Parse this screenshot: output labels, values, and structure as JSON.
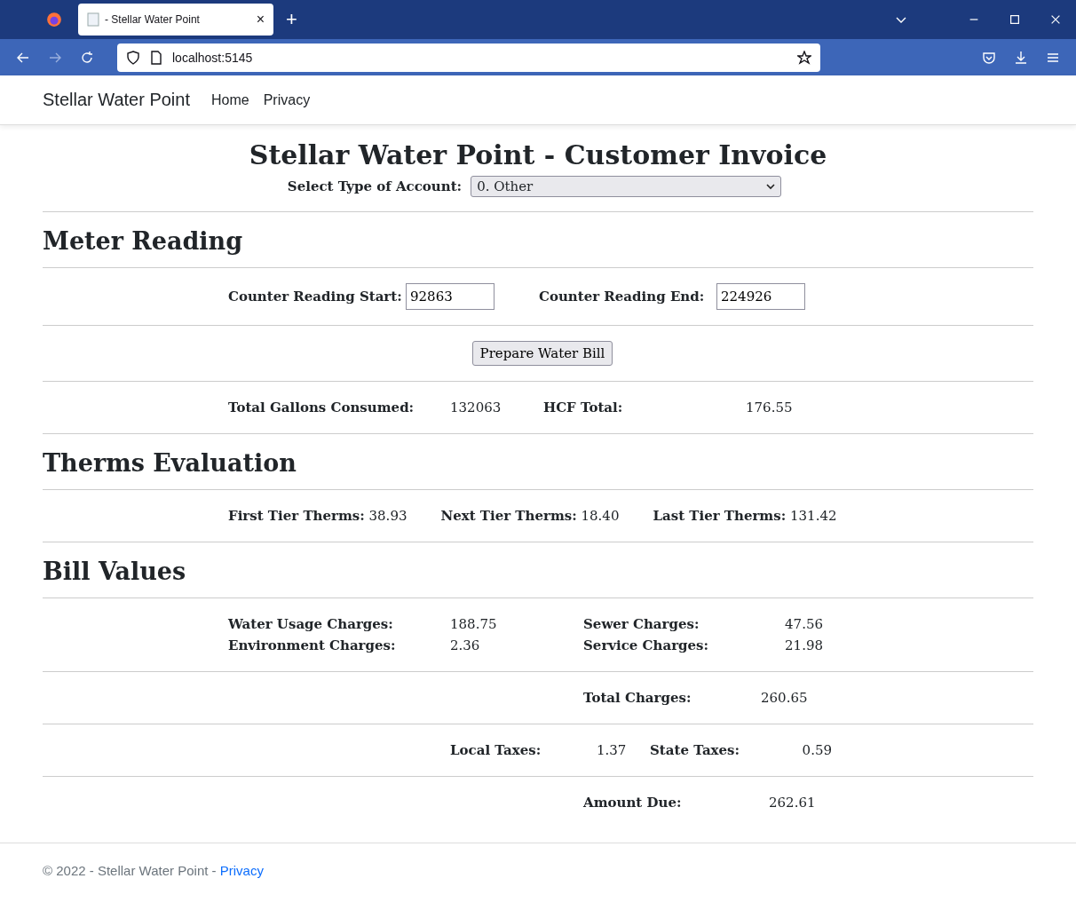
{
  "browser": {
    "tab_title": "- Stellar Water Point",
    "tab_close": "×",
    "new_tab": "+",
    "url": "localhost:5145"
  },
  "navbar": {
    "brand": "Stellar Water Point",
    "links": [
      "Home",
      "Privacy"
    ]
  },
  "title": "Stellar Water Point - Customer Invoice",
  "account": {
    "label": "Select Type of Account:",
    "value": "0. Other"
  },
  "meter": {
    "heading": "Meter Reading",
    "start": {
      "label": "Counter Reading Start:",
      "value": "92863"
    },
    "end": {
      "label": "Counter Reading End:",
      "value": "224926"
    }
  },
  "button": "Prepare Water Bill",
  "consumption": [
    {
      "label": "Total Gallons Consumed:",
      "value": "132063"
    },
    {
      "label": "HCF Total:",
      "value": "176.55"
    }
  ],
  "therms": {
    "heading": "Therms Evaluation",
    "tiers": [
      {
        "label": "First Tier Therms:",
        "value": "38.93"
      },
      {
        "label": "Next Tier Therms:",
        "value": "18.40"
      },
      {
        "label": "Last Tier Therms:",
        "value": "131.42"
      }
    ]
  },
  "bill": {
    "heading": "Bill Values",
    "charges": [
      {
        "label": "Water Usage Charges:",
        "value": "188.75"
      },
      {
        "label": "Sewer Charges:",
        "value": "47.56"
      },
      {
        "label": "Environment Charges:",
        "value": "2.36"
      },
      {
        "label": "Service Charges:",
        "value": "21.98"
      }
    ],
    "total": {
      "label": "Total Charges:",
      "value": "260.65"
    },
    "taxes": [
      {
        "label": "Local Taxes:",
        "value": "1.37"
      },
      {
        "label": "State Taxes:",
        "value": "0.59"
      }
    ],
    "amount_due": {
      "label": "Amount Due:",
      "value": "262.61"
    }
  },
  "footer": {
    "text": "© 2022 - Stellar Water Point -",
    "link": "Privacy"
  }
}
